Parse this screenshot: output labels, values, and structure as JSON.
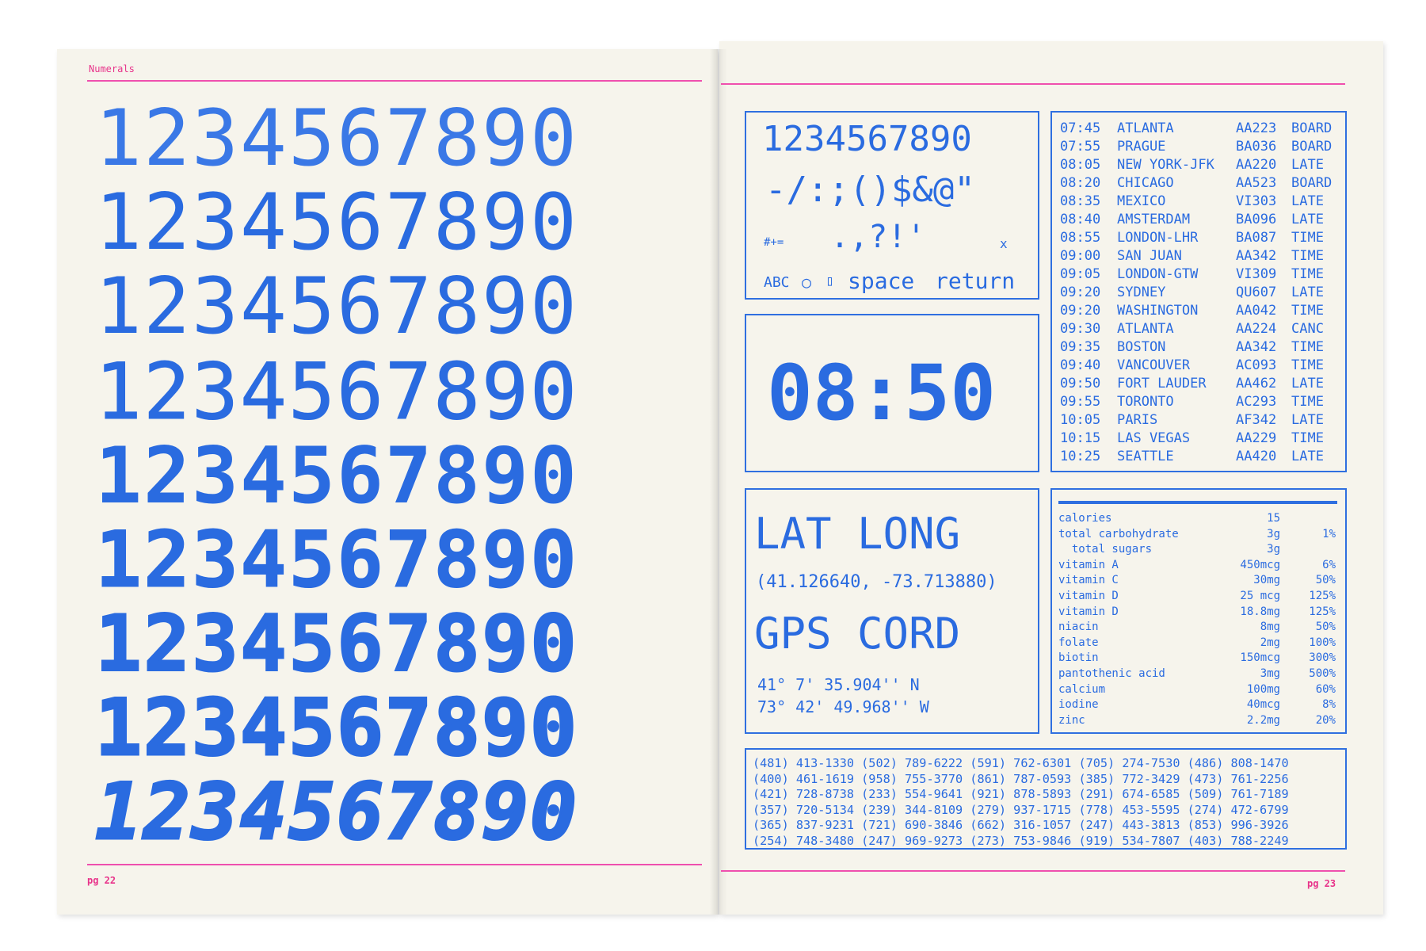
{
  "left_page": {
    "section_label": "Numerals",
    "numerals": "1234567890",
    "folio": "pg 22"
  },
  "right_page": {
    "folio": "pg 23",
    "keyboard": {
      "digits": "1234567890",
      "symbols": "-/:;()$&@\"",
      "modifier": "#+=",
      "punct": ".,?!'",
      "close": "x",
      "abc": "ABC",
      "globe_icon": "○",
      "mic_icon": "▯",
      "space": "space",
      "return": "return"
    },
    "clock": "08:50",
    "flights": [
      [
        "07:45",
        "ATLANTA",
        "AA223",
        "BOARD"
      ],
      [
        "07:55",
        "PRAGUE",
        "BA036",
        "BOARD"
      ],
      [
        "08:05",
        "NEW YORK-JFK",
        "AA220",
        "LATE"
      ],
      [
        "08:20",
        "CHICAGO",
        "AA523",
        "BOARD"
      ],
      [
        "08:35",
        "MEXICO",
        "VI303",
        "LATE"
      ],
      [
        "08:40",
        "AMSTERDAM",
        "BA096",
        "LATE"
      ],
      [
        "08:55",
        "LONDON-LHR",
        "BA087",
        "TIME"
      ],
      [
        "09:00",
        "SAN JUAN",
        "AA342",
        "TIME"
      ],
      [
        "09:05",
        "LONDON-GTW",
        "VI309",
        "TIME"
      ],
      [
        "09:20",
        "SYDNEY",
        "QU607",
        "LATE"
      ],
      [
        "09:20",
        "WASHINGTON",
        "AA042",
        "TIME"
      ],
      [
        "09:30",
        "ATLANTA",
        "AA224",
        "CANC"
      ],
      [
        "09:35",
        "BOSTON",
        "AA342",
        "TIME"
      ],
      [
        "09:40",
        "VANCOUVER",
        "AC093",
        "TIME"
      ],
      [
        "09:50",
        "FORT LAUDER",
        "AA462",
        "LATE"
      ],
      [
        "09:55",
        "TORONTO",
        "AC293",
        "TIME"
      ],
      [
        "10:05",
        "PARIS",
        "AF342",
        "LATE"
      ],
      [
        "10:15",
        "LAS VEGAS",
        "AA229",
        "TIME"
      ],
      [
        "10:25",
        "SEATTLE",
        "AA420",
        "LATE"
      ]
    ],
    "gps": {
      "heading1": "LAT LONG",
      "coords": "(41.126640, -73.713880)",
      "heading2": "GPS CORD",
      "lat": "41° 7' 35.904'' N",
      "long": "73° 42' 49.968'' W"
    },
    "nutrition": [
      [
        "calories",
        "15",
        ""
      ],
      [
        "total carbohydrate",
        "3g",
        "1%"
      ],
      [
        "  total sugars",
        "3g",
        ""
      ],
      [
        "vitamin A",
        "450mcg",
        "6%"
      ],
      [
        "vitamin C",
        "30mg",
        "50%"
      ],
      [
        "vitamin D",
        "25 mcg",
        "125%"
      ],
      [
        "vitamin D",
        "18.8mg",
        "125%"
      ],
      [
        "niacin",
        "8mg",
        "50%"
      ],
      [
        "folate",
        "2mg",
        "100%"
      ],
      [
        "biotin",
        "150mcg",
        "300%"
      ],
      [
        "pantothenic acid",
        "3mg",
        "500%"
      ],
      [
        "calcium",
        "100mg",
        "60%"
      ],
      [
        "iodine",
        "40mcg",
        "8%"
      ],
      [
        "zinc",
        "2.2mg",
        "20%"
      ]
    ],
    "phones": [
      "(481) 413-1330 (502) 789-6222 (591) 762-6301 (705) 274-7530 (486) 808-1470",
      "(400) 461-1619 (958) 755-3770 (861) 787-0593 (385) 772-3429 (473) 761-2256",
      "(421) 728-8738 (233) 554-9641 (921) 878-5893 (291) 674-6585 (509) 761-7189",
      "(357) 720-5134 (239) 344-8109 (279) 937-1715 (778) 453-5595 (274) 472-6799",
      "(365) 837-9231 (721) 690-3846 (662) 316-1057 (247) 443-3813 (853) 996-3926",
      "(254) 748-3480 (247) 969-9273 (273) 753-9846 (919) 534-7807 (403) 788-2249"
    ]
  },
  "colors": {
    "ink_blue": "#2a6be0",
    "accent_pink": "#ef4fae",
    "paper": "#f6f4ec"
  }
}
